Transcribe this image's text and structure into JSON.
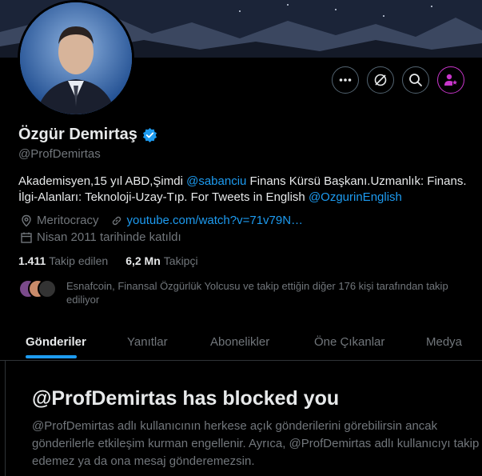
{
  "profile": {
    "name": "Özgür Demirtaş",
    "handle": "@ProfDemirtas",
    "bio": {
      "part1": "Akademisyen,15 yıl ABD,Şimdi ",
      "mention1": "@sabanciu",
      "part2": " Finans Kürsü Başkanı.Uzmanlık: Finans. İlgi-Alanları: Teknoloji-Uzay-Tıp. For Tweets in English ",
      "mention2": "@OzgurinEnglish"
    },
    "location": "Meritocracy",
    "website": "youtube.com/watch?v=71v79N…",
    "joined": "Nisan 2011 tarihinde katıldı",
    "following_count": "1.411",
    "following_label": "Takip edilen",
    "followers_count": "6,2 Mn",
    "followers_label": "Takipçi",
    "mutuals_text": "Esnafcoin, Finansal Özgürlük Yolcusu ve takip ettiğin diğer 176 kişi tarafından takip ediliyor"
  },
  "actions": [
    {
      "icon": "more-icon"
    },
    {
      "icon": "grok-icon"
    },
    {
      "icon": "search-icon"
    },
    {
      "icon": "subscribe-icon"
    }
  ],
  "tabs": [
    {
      "label": "Gönderiler",
      "active": true
    },
    {
      "label": "Yanıtlar",
      "active": false
    },
    {
      "label": "Abonelikler",
      "active": false
    },
    {
      "label": "Öne Çıkanlar",
      "active": false
    },
    {
      "label": "Medya",
      "active": false
    }
  ],
  "blocked": {
    "title": "@ProfDemirtas has blocked you",
    "description": "@ProfDemirtas adlı kullanıcının herkese açık gönderilerini görebilirsin ancak gönderilerle etkileşim kurman engellenir. Ayrıca, @ProfDemirtas adlı kullanıcıyı takip edemez ya da ona mesaj gönderemezsin."
  },
  "colors": {
    "accent": "#1d9bf0",
    "subscribe": "#c936cc",
    "muted": "#71767b",
    "text": "#e7e9ea",
    "background": "#000000"
  }
}
